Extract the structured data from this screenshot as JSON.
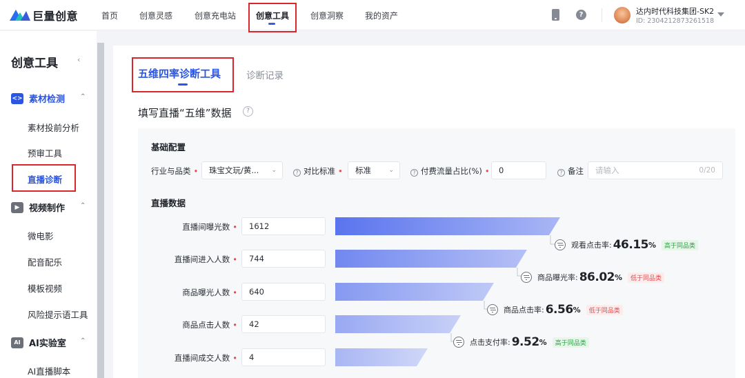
{
  "brand": {
    "name": "巨量创意"
  },
  "nav": {
    "items": [
      "首页",
      "创意灵感",
      "创意充电站",
      "创意工具",
      "创意洞察",
      "我的资产"
    ],
    "active_index": 3
  },
  "account": {
    "name": "达内时代科技集团-SK2",
    "id": "ID: 2304212873261518"
  },
  "sidebar": {
    "title": "创意工具",
    "groups": [
      {
        "label": "素材检测",
        "icon": "code-icon",
        "items": [
          "素材投前分析",
          "预审工具",
          "直播诊断"
        ]
      },
      {
        "label": "视频制作",
        "icon": "play-icon",
        "items": [
          "微电影",
          "配音配乐",
          "模板视频",
          "风险提示语工具"
        ]
      },
      {
        "label": "AI实验室",
        "icon": "ai-icon",
        "items": [
          "AI直播脚本"
        ]
      }
    ],
    "active_item": "直播诊断"
  },
  "tabs": {
    "active": "五维四率诊断工具",
    "other": "诊断记录"
  },
  "form": {
    "title": "填写直播“五维”数据",
    "basic_section": "基础配置",
    "industry_label": "行业与品类",
    "industry_value": "珠宝文玩/黄...",
    "compare_label": "对比标准",
    "compare_value": "标准",
    "paid_label": "付费流量占比(%)",
    "paid_value": "0",
    "note_label": "备注",
    "note_placeholder": "请输入",
    "note_count": "0/20",
    "live_section": "直播数据"
  },
  "funnel": {
    "rows": [
      {
        "label": "直播间曝光数",
        "value": "1612"
      },
      {
        "label": "直播间进入人数",
        "value": "744"
      },
      {
        "label": "商品曝光人数",
        "value": "640"
      },
      {
        "label": "商品点击人数",
        "value": "42"
      },
      {
        "label": "直播间成交人数",
        "value": "4"
      }
    ],
    "rates": [
      {
        "label": "观看点击率:",
        "value": "46.15",
        "unit": "%",
        "badge": "高于同品类",
        "status": "high"
      },
      {
        "label": "商品曝光率:",
        "value": "86.02",
        "unit": "%",
        "badge": "低于同品类",
        "status": "low"
      },
      {
        "label": "商品点击率:",
        "value": "6.56",
        "unit": "%",
        "badge": "低于同品类",
        "status": "low"
      },
      {
        "label": "点击支付率:",
        "value": "9.52",
        "unit": "%",
        "badge": "高于同品类",
        "status": "high"
      }
    ],
    "color_start": "#5a74ee",
    "color_end": "#a9b6f5"
  }
}
